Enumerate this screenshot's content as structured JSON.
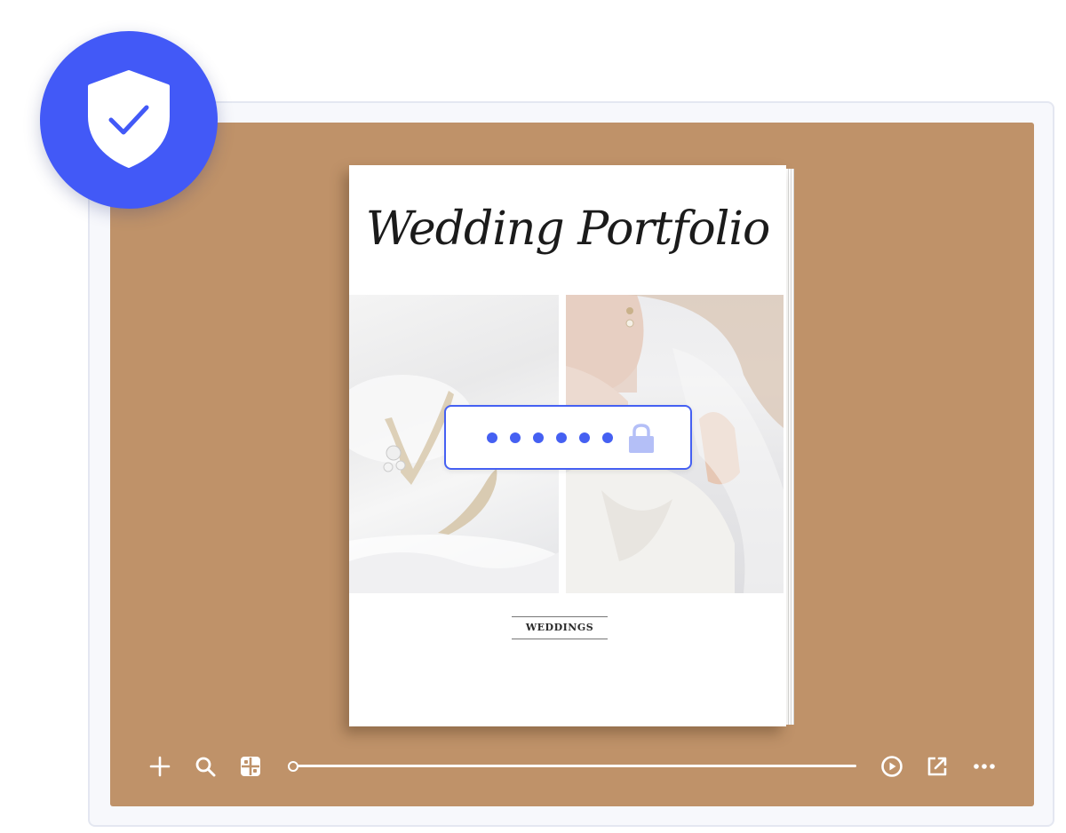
{
  "book": {
    "title": "Wedding Portfolio",
    "caption": "WEDDINGS"
  },
  "photos": [
    {
      "description_icon": "bridal-shoes-photo"
    },
    {
      "description_icon": "bride-veil-photo"
    }
  ],
  "password": {
    "masked_length": 6,
    "icon": "lock-icon"
  },
  "badge": {
    "icon": "shield-check-icon",
    "color": "#4259f7"
  },
  "toolbar": {
    "buttons": [
      "plus-icon",
      "search-icon",
      "grid-icon",
      "play-icon",
      "share-icon",
      "more-icon"
    ],
    "progress": 0
  },
  "colors": {
    "stage": "#bf9269",
    "accent": "#4560f2",
    "lock": "#b4bff7"
  }
}
